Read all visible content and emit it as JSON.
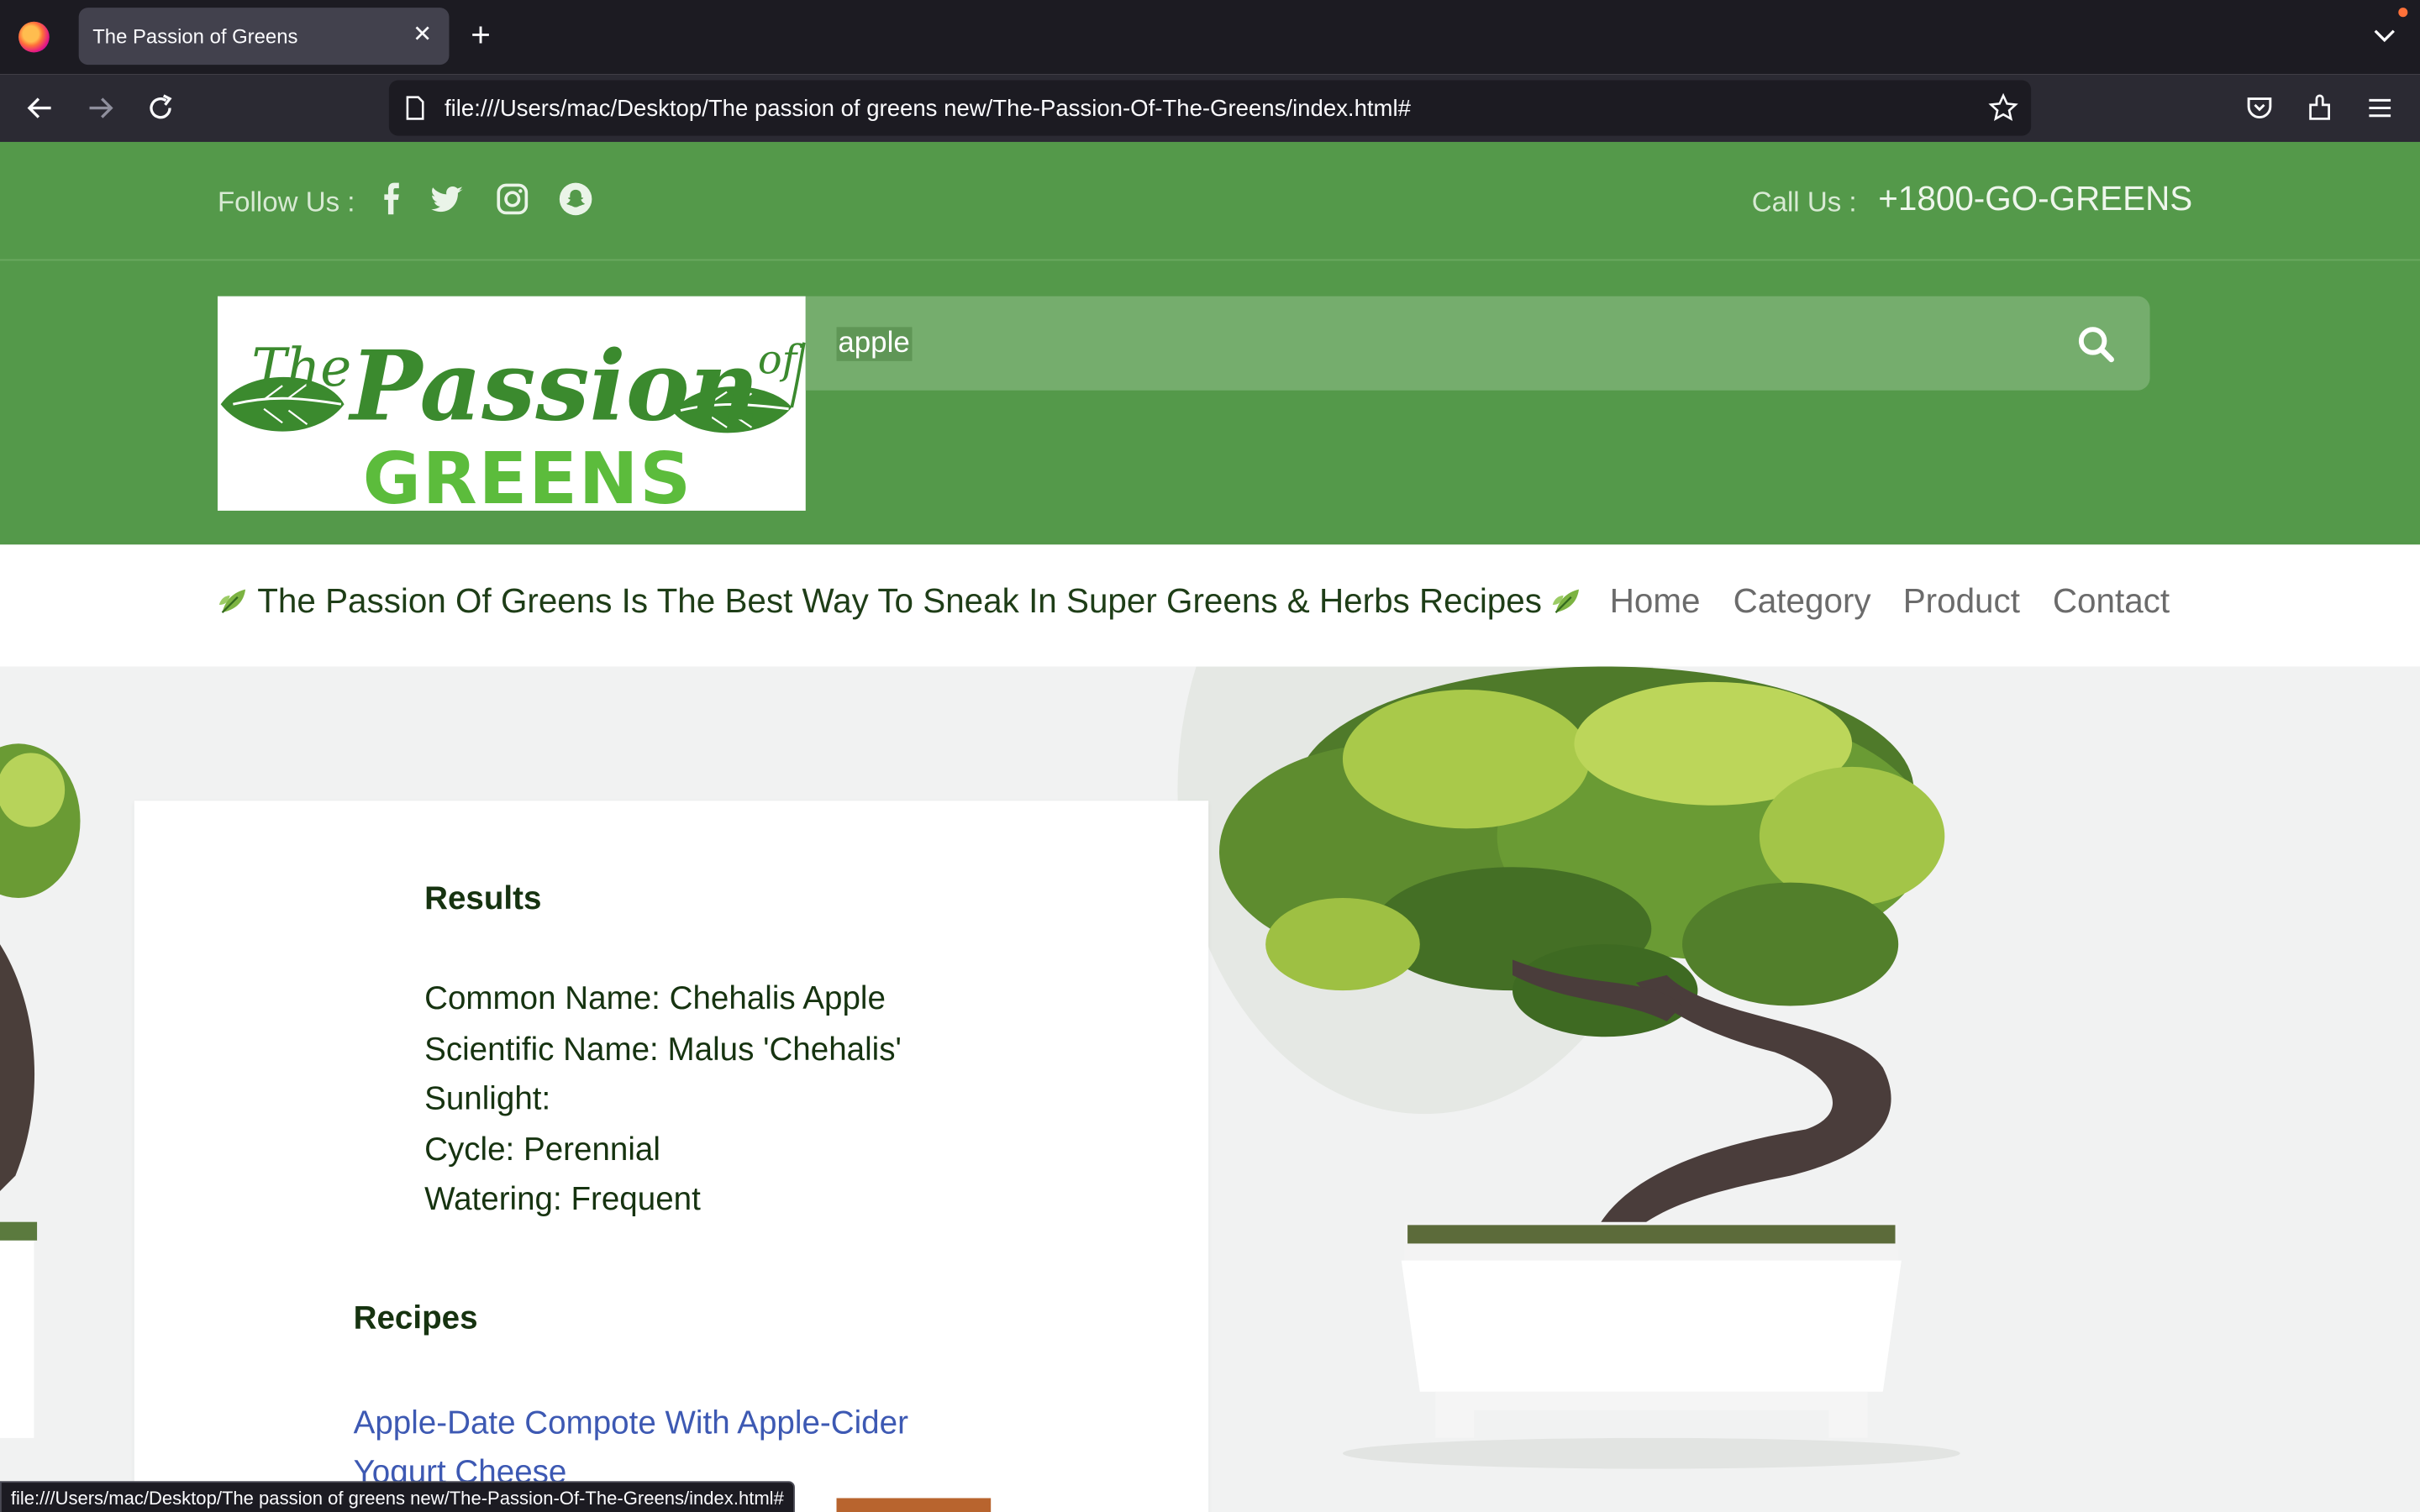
{
  "browser": {
    "tab_title": "The Passion of Greens",
    "url": "file:///Users/mac/Desktop/The passion of greens new/The-Passion-Of-The-Greens/index.html#",
    "status_url": "file:///Users/mac/Desktop/The passion of greens new/The-Passion-Of-The-Greens/index.html#"
  },
  "header": {
    "follow_label": "Follow Us :",
    "social_icons": [
      "facebook-icon",
      "twitter-icon",
      "instagram-icon",
      "snapchat-icon"
    ],
    "call_label": "Call Us :",
    "phone": "+1800-GO-GREENS"
  },
  "logo": {
    "text_the": "The",
    "text_passion": "Passion",
    "text_of": "of",
    "text_greens": "GREENS"
  },
  "search": {
    "value": "apple"
  },
  "nav": {
    "tagline": "The Passion Of Greens Is The Best Way To Sneak In Super Greens & Herbs Recipes",
    "links": [
      "Home",
      "Category",
      "Product",
      "Contact"
    ]
  },
  "results": {
    "heading": "Results",
    "common_name": "Common Name: Chehalis Apple",
    "scientific_name": "Scientific Name: Malus 'Chehalis'",
    "sunlight": "Sunlight:",
    "cycle": "Cycle: Perennial",
    "watering": "Watering: Frequent"
  },
  "recipes": {
    "heading": "Recipes",
    "items": [
      "Apple-Date Compote With Apple-Cider Yogurt Cheese"
    ]
  },
  "colors": {
    "brand_green": "#54994a",
    "dark_green_text": "#163310",
    "link_blue": "#3d59b3"
  }
}
